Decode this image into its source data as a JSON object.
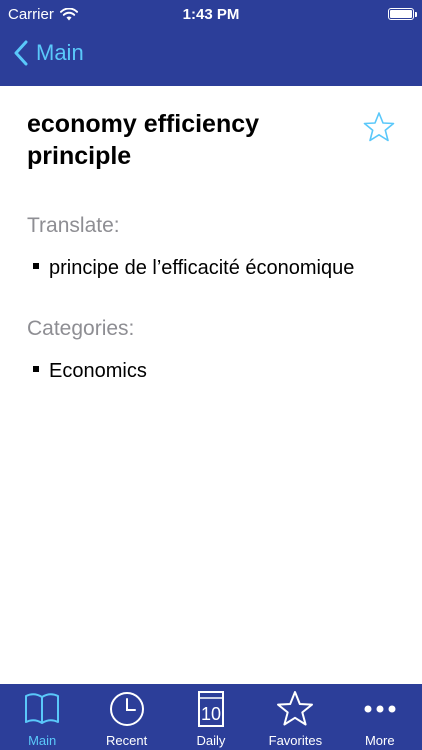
{
  "status_bar": {
    "carrier": "Carrier",
    "time": "1:43 PM"
  },
  "navbar": {
    "back_label": "Main"
  },
  "entry": {
    "title": "economy efficiency principle",
    "translate_label": "Translate:",
    "translations": [
      "principe de l’efficacité économique"
    ],
    "categories_label": "Categories:",
    "categories": [
      "Economics"
    ]
  },
  "tabbar": {
    "tabs": [
      {
        "label": "Main",
        "icon": "book-icon",
        "active": true
      },
      {
        "label": "Recent",
        "icon": "clock-icon",
        "active": false
      },
      {
        "label": "Daily",
        "icon": "calendar-icon",
        "active": false
      },
      {
        "label": "Favorites",
        "icon": "star-icon",
        "active": false
      },
      {
        "label": "More",
        "icon": "more-icon",
        "active": false
      }
    ],
    "daily_number": "10"
  },
  "colors": {
    "bar": "#2c3e99",
    "accent": "#5ac8fa",
    "label_gray": "#8e8e93"
  }
}
